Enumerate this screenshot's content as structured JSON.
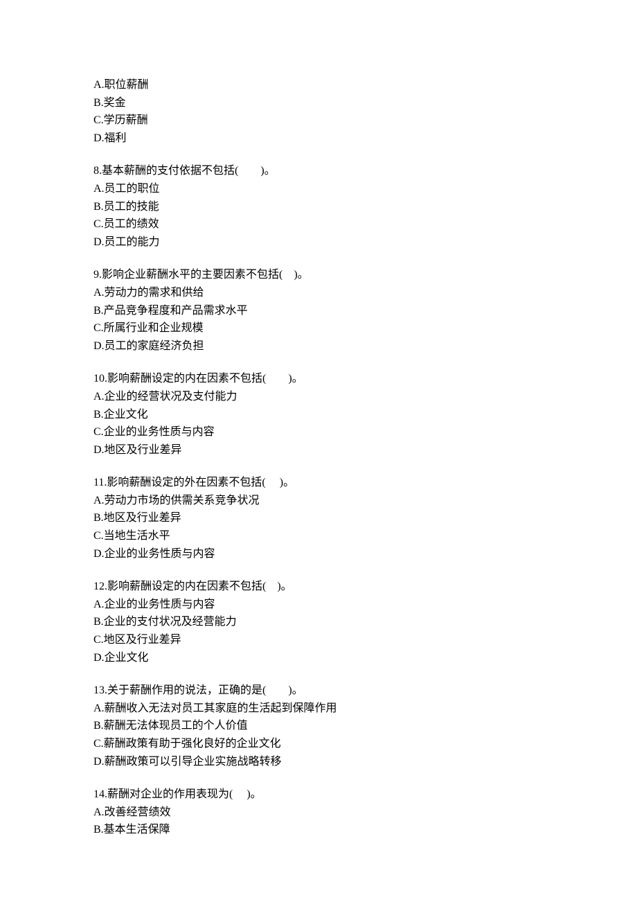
{
  "q7_options": {
    "a": "A.职位薪酬",
    "b": "B.奖金",
    "c": "C.学历薪酬",
    "d": "D.福利"
  },
  "q8": {
    "question": "8.基本薪酬的支付依据不包括(　　)。",
    "a": "A.员工的职位",
    "b": "B.员工的技能",
    "c": "C.员工的绩效",
    "d": "D.员工的能力"
  },
  "q9": {
    "question": "9.影响企业薪酬水平的主要因素不包括(　)。",
    "a": "A.劳动力的需求和供给",
    "b": "B.产品竞争程度和产品需求水平",
    "c": "C.所属行业和企业规模",
    "d": "D.员工的家庭经济负担"
  },
  "q10": {
    "question": "10.影响薪酬设定的内在因素不包括(　　)。",
    "a": "A.企业的经营状况及支付能力",
    "b": "B.企业文化",
    "c": "C.企业的业务性质与内容",
    "d": "D.地区及行业差异"
  },
  "q11": {
    "question": "11.影响薪酬设定的外在因素不包括(　 )。",
    "a": "A.劳动力市场的供需关系竞争状况",
    "b": "B.地区及行业差异",
    "c": "C.当地生活水平",
    "d": "D.企业的业务性质与内容"
  },
  "q12": {
    "question": "12.影响薪酬设定的内在因素不包括(　)。",
    "a": "A.企业的业务性质与内容",
    "b": "B.企业的支付状况及经营能力",
    "c": "C.地区及行业差异",
    "d": "D.企业文化"
  },
  "q13": {
    "question": "13.关于薪酬作用的说法，正确的是(　　)。",
    "a": "A.薪酬收入无法对员工其家庭的生活起到保障作用",
    "b": "B.薪酬无法体现员工的个人价值",
    "c": "C.薪酬政策有助于强化良好的企业文化",
    "d": "D.薪酬政策可以引导企业实施战略转移"
  },
  "q14": {
    "question": "14.薪酬对企业的作用表现为(　 )。",
    "a": "A.改善经营绩效",
    "b": "B.基本生活保障"
  }
}
